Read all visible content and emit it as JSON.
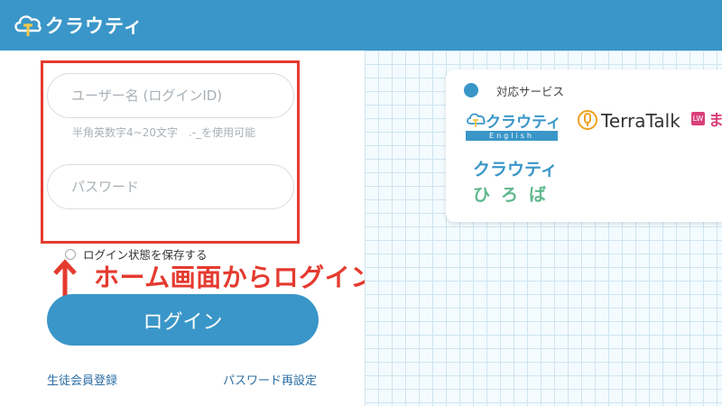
{
  "header": {
    "app_name": "クラウティ",
    "logo_icon": "cloud-tree-icon",
    "background_color": "#3a96c8"
  },
  "login_form": {
    "username": {
      "placeholder": "ユーザー名 (ログインID)",
      "value": ""
    },
    "username_hint": "半角英数字4~20文字　.-_を使用可能",
    "password": {
      "placeholder": "パスワード",
      "value": ""
    },
    "remember_label": "ログイン状態を保存する",
    "remember_checked": false,
    "login_button_label": "ログイン",
    "register_link": "生徒会員登録",
    "reset_password_link": "パスワード再設定"
  },
  "annotation": {
    "text": "ホーム画面からログイン",
    "color": "#e53a2f",
    "arrow_icon": "arrow-up-icon"
  },
  "services": {
    "title": "対応サービス",
    "logos": {
      "clouty_english": {
        "name": "クラウティ",
        "sub": "English"
      },
      "terratalk": {
        "name": "TerraTalk",
        "icon": "microphone-icon"
      },
      "third": {
        "badge": "LW",
        "name": "ま"
      },
      "clouty_hiroba": {
        "line1": "クラウティ",
        "line2": "ひろば"
      }
    }
  }
}
